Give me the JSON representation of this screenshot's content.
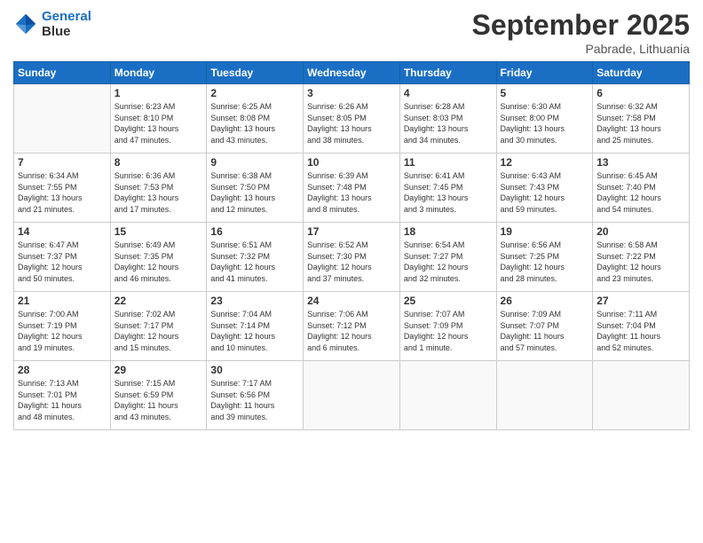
{
  "logo": {
    "line1": "General",
    "line2": "Blue"
  },
  "title": "September 2025",
  "location": "Pabrade, Lithuania",
  "weekdays": [
    "Sunday",
    "Monday",
    "Tuesday",
    "Wednesday",
    "Thursday",
    "Friday",
    "Saturday"
  ],
  "weeks": [
    [
      {
        "day": "",
        "info": ""
      },
      {
        "day": "1",
        "info": "Sunrise: 6:23 AM\nSunset: 8:10 PM\nDaylight: 13 hours\nand 47 minutes."
      },
      {
        "day": "2",
        "info": "Sunrise: 6:25 AM\nSunset: 8:08 PM\nDaylight: 13 hours\nand 43 minutes."
      },
      {
        "day": "3",
        "info": "Sunrise: 6:26 AM\nSunset: 8:05 PM\nDaylight: 13 hours\nand 38 minutes."
      },
      {
        "day": "4",
        "info": "Sunrise: 6:28 AM\nSunset: 8:03 PM\nDaylight: 13 hours\nand 34 minutes."
      },
      {
        "day": "5",
        "info": "Sunrise: 6:30 AM\nSunset: 8:00 PM\nDaylight: 13 hours\nand 30 minutes."
      },
      {
        "day": "6",
        "info": "Sunrise: 6:32 AM\nSunset: 7:58 PM\nDaylight: 13 hours\nand 25 minutes."
      }
    ],
    [
      {
        "day": "7",
        "info": "Sunrise: 6:34 AM\nSunset: 7:55 PM\nDaylight: 13 hours\nand 21 minutes."
      },
      {
        "day": "8",
        "info": "Sunrise: 6:36 AM\nSunset: 7:53 PM\nDaylight: 13 hours\nand 17 minutes."
      },
      {
        "day": "9",
        "info": "Sunrise: 6:38 AM\nSunset: 7:50 PM\nDaylight: 13 hours\nand 12 minutes."
      },
      {
        "day": "10",
        "info": "Sunrise: 6:39 AM\nSunset: 7:48 PM\nDaylight: 13 hours\nand 8 minutes."
      },
      {
        "day": "11",
        "info": "Sunrise: 6:41 AM\nSunset: 7:45 PM\nDaylight: 13 hours\nand 3 minutes."
      },
      {
        "day": "12",
        "info": "Sunrise: 6:43 AM\nSunset: 7:43 PM\nDaylight: 12 hours\nand 59 minutes."
      },
      {
        "day": "13",
        "info": "Sunrise: 6:45 AM\nSunset: 7:40 PM\nDaylight: 12 hours\nand 54 minutes."
      }
    ],
    [
      {
        "day": "14",
        "info": "Sunrise: 6:47 AM\nSunset: 7:37 PM\nDaylight: 12 hours\nand 50 minutes."
      },
      {
        "day": "15",
        "info": "Sunrise: 6:49 AM\nSunset: 7:35 PM\nDaylight: 12 hours\nand 46 minutes."
      },
      {
        "day": "16",
        "info": "Sunrise: 6:51 AM\nSunset: 7:32 PM\nDaylight: 12 hours\nand 41 minutes."
      },
      {
        "day": "17",
        "info": "Sunrise: 6:52 AM\nSunset: 7:30 PM\nDaylight: 12 hours\nand 37 minutes."
      },
      {
        "day": "18",
        "info": "Sunrise: 6:54 AM\nSunset: 7:27 PM\nDaylight: 12 hours\nand 32 minutes."
      },
      {
        "day": "19",
        "info": "Sunrise: 6:56 AM\nSunset: 7:25 PM\nDaylight: 12 hours\nand 28 minutes."
      },
      {
        "day": "20",
        "info": "Sunrise: 6:58 AM\nSunset: 7:22 PM\nDaylight: 12 hours\nand 23 minutes."
      }
    ],
    [
      {
        "day": "21",
        "info": "Sunrise: 7:00 AM\nSunset: 7:19 PM\nDaylight: 12 hours\nand 19 minutes."
      },
      {
        "day": "22",
        "info": "Sunrise: 7:02 AM\nSunset: 7:17 PM\nDaylight: 12 hours\nand 15 minutes."
      },
      {
        "day": "23",
        "info": "Sunrise: 7:04 AM\nSunset: 7:14 PM\nDaylight: 12 hours\nand 10 minutes."
      },
      {
        "day": "24",
        "info": "Sunrise: 7:06 AM\nSunset: 7:12 PM\nDaylight: 12 hours\nand 6 minutes."
      },
      {
        "day": "25",
        "info": "Sunrise: 7:07 AM\nSunset: 7:09 PM\nDaylight: 12 hours\nand 1 minute."
      },
      {
        "day": "26",
        "info": "Sunrise: 7:09 AM\nSunset: 7:07 PM\nDaylight: 11 hours\nand 57 minutes."
      },
      {
        "day": "27",
        "info": "Sunrise: 7:11 AM\nSunset: 7:04 PM\nDaylight: 11 hours\nand 52 minutes."
      }
    ],
    [
      {
        "day": "28",
        "info": "Sunrise: 7:13 AM\nSunset: 7:01 PM\nDaylight: 11 hours\nand 48 minutes."
      },
      {
        "day": "29",
        "info": "Sunrise: 7:15 AM\nSunset: 6:59 PM\nDaylight: 11 hours\nand 43 minutes."
      },
      {
        "day": "30",
        "info": "Sunrise: 7:17 AM\nSunset: 6:56 PM\nDaylight: 11 hours\nand 39 minutes."
      },
      {
        "day": "",
        "info": ""
      },
      {
        "day": "",
        "info": ""
      },
      {
        "day": "",
        "info": ""
      },
      {
        "day": "",
        "info": ""
      }
    ]
  ]
}
